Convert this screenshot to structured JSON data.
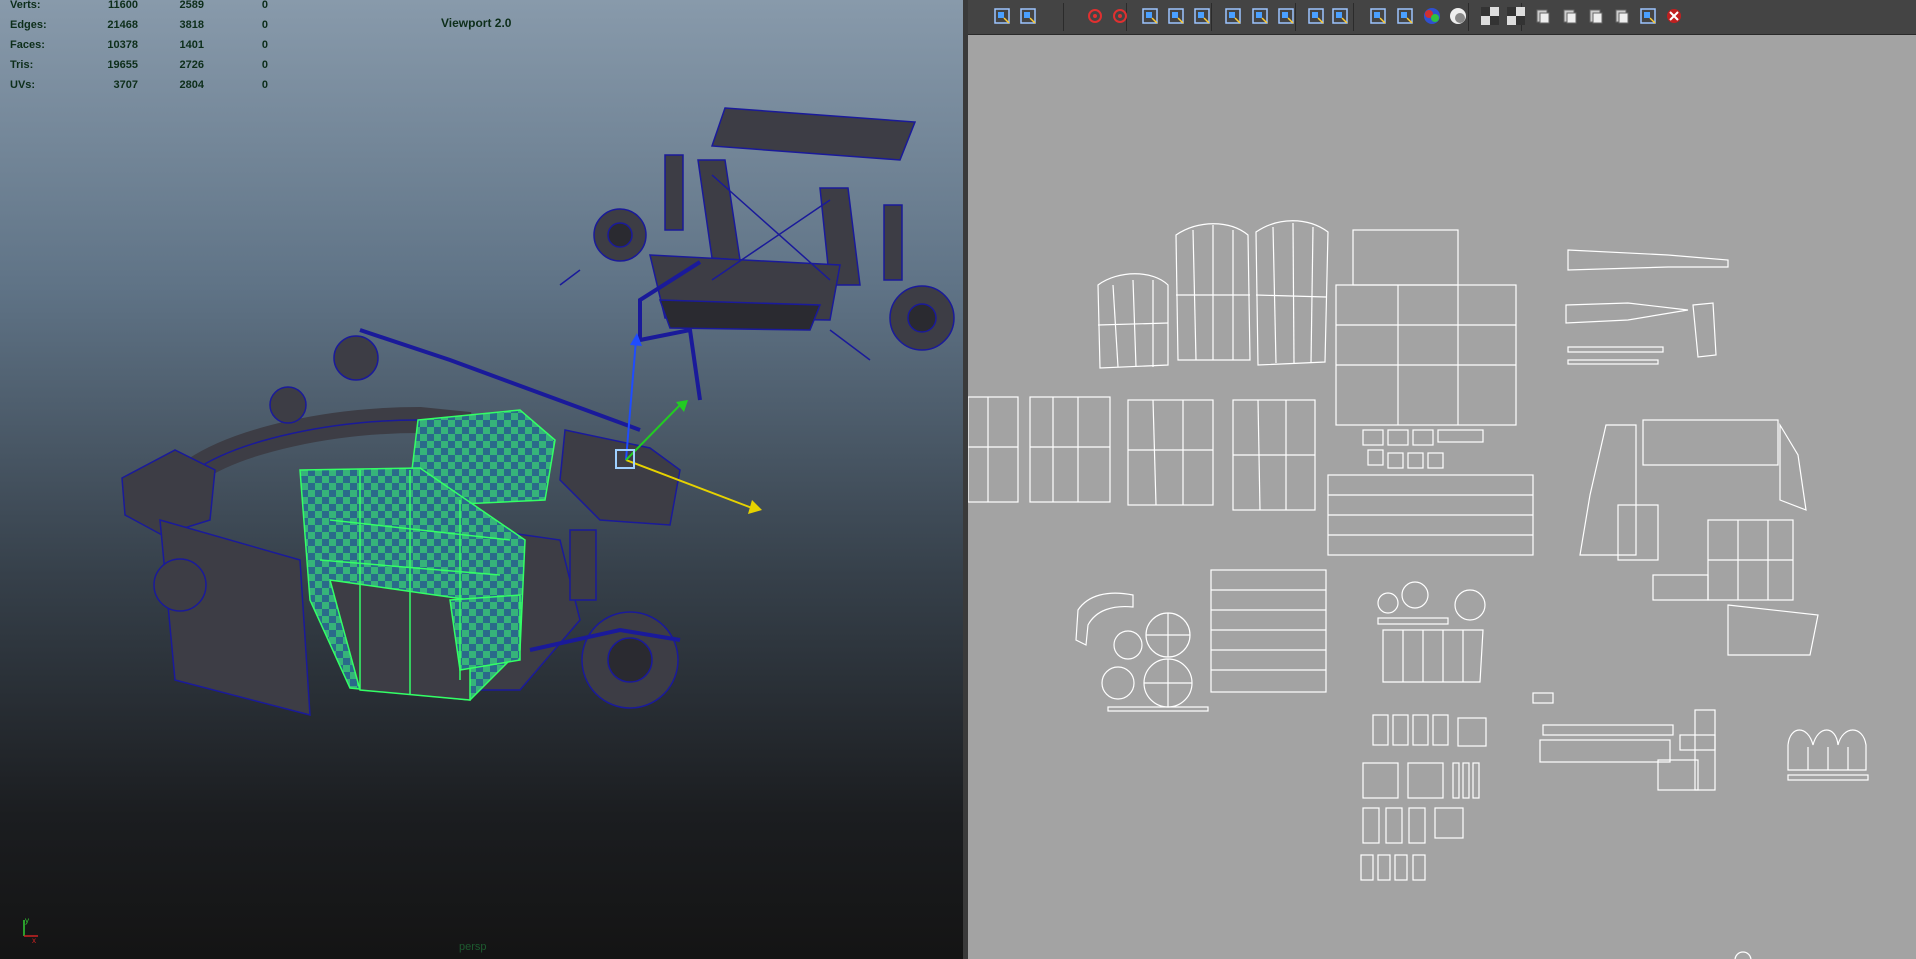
{
  "viewport": {
    "title": "Viewport 2.0",
    "camera": "persp",
    "stats": [
      {
        "label": "Verts:",
        "values": [
          "11600",
          "2589",
          "0"
        ]
      },
      {
        "label": "Edges:",
        "values": [
          "21468",
          "3818",
          "0"
        ]
      },
      {
        "label": "Faces:",
        "values": [
          "10378",
          "1401",
          "0"
        ]
      },
      {
        "label": "Tris:",
        "values": [
          "19655",
          "2726",
          "0"
        ]
      },
      {
        "label": "UVs:",
        "values": [
          "3707",
          "2804",
          "0"
        ]
      }
    ],
    "axis": {
      "y": "y",
      "x": "x"
    }
  },
  "uv_toolbar": {
    "icons": [
      "uv-frame-all-icon",
      "uv-select-icon",
      "rotate-ccw-icon",
      "rotate-cw-icon",
      "uv-snapshot-icon",
      "uv-move-icon",
      "uv-layout-icon",
      "uv-cut-icon",
      "uv-split-icon",
      "uv-sew-icon",
      "uv-grid-icon",
      "uv-align-icon",
      "uv-image-icon",
      "uv-display-icon",
      "color-rgb-icon",
      "shading-icon",
      "checker-icon",
      "checker-map-icon",
      "copy-uv-icon",
      "paste-uv-icon",
      "paste-u-icon",
      "paste-v-icon",
      "uv-options-icon",
      "uv-delete-icon"
    ]
  },
  "colors": {
    "selection_green": "#33ff66",
    "wire_blue": "#1a1a9a",
    "uv_background": "#a3a3a3",
    "uv_lines": "#ffffff",
    "gizmo_x": "#e6d200",
    "gizmo_y": "#1f4cff",
    "gizmo_z": "#22cc22"
  }
}
